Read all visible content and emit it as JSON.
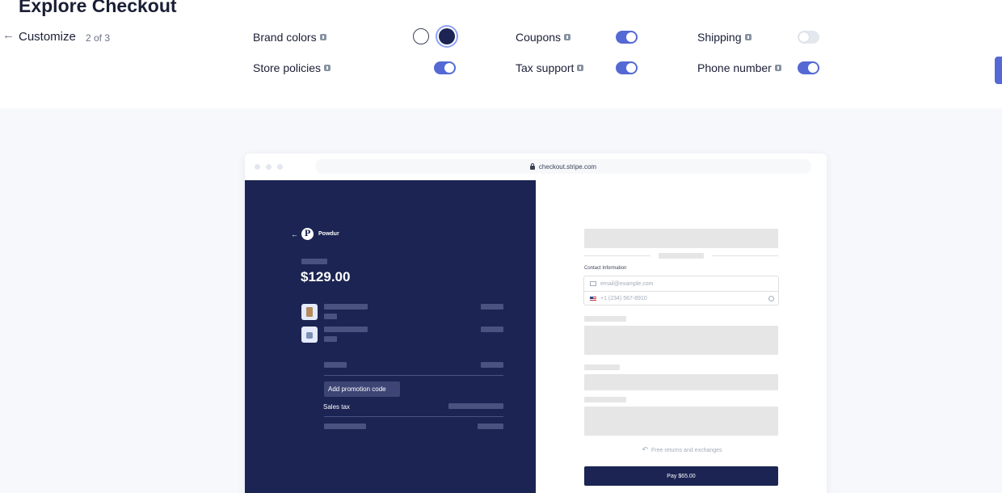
{
  "header": {
    "title": "Explore Checkout",
    "step_title": "Customize",
    "step_count": "2 of 3",
    "back_icon": "arrow-left-icon"
  },
  "options": {
    "brand_colors": {
      "label": "Brand colors",
      "selected": "#1b2452",
      "swatches": [
        "#ffffff",
        "#1b2452"
      ]
    },
    "store_policies": {
      "label": "Store policies",
      "enabled": true
    },
    "coupons": {
      "label": "Coupons",
      "enabled": true
    },
    "tax_support": {
      "label": "Tax support",
      "enabled": true
    },
    "shipping": {
      "label": "Shipping",
      "enabled": false
    },
    "phone_number": {
      "label": "Phone number",
      "enabled": true
    }
  },
  "colors": {
    "accent": "#5469d4",
    "brand_navy": "#1b2452",
    "canvas_bg": "#f6f8fb"
  },
  "browser": {
    "url": "checkout.stripe.com"
  },
  "checkout": {
    "merchant_name": "Powdur",
    "merchant_logo_letter": "P",
    "total": "$129.00",
    "promo_label": "Add promotion code",
    "sales_tax_label": "Sales tax",
    "contact_label": "Contact Information",
    "email_placeholder": "email@example.com",
    "phone_placeholder": "+1 (234) 567-8910",
    "returns_text": "Free returns and exchanges",
    "pay_label": "Pay $65.00"
  }
}
